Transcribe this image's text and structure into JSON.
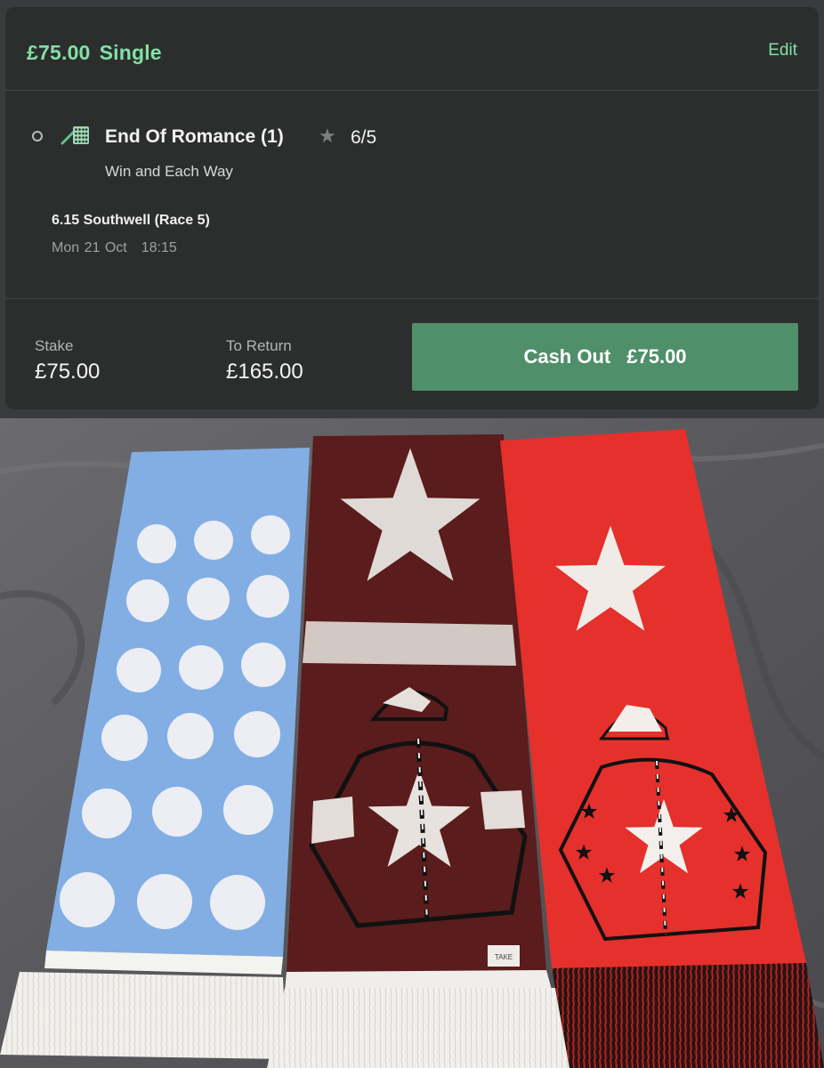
{
  "bet": {
    "amount": "£75.00",
    "type": "Single",
    "edit_label": "Edit",
    "selection": {
      "name": "End Of Romance (1)",
      "odds": "6/5",
      "market": "Win and Each Way",
      "race": "6.15 Southwell (Race 5)",
      "date": "Mon 21 Oct",
      "time": "18:15"
    },
    "stake_label": "Stake",
    "stake_value": "£75.00",
    "return_label": "To Return",
    "return_value": "£165.00",
    "cashout_label": "Cash Out",
    "cashout_value": "£75.00"
  },
  "colors": {
    "accent_green": "#82e0a6",
    "cashout_button": "#4f8f6a",
    "card_bg": "#2c2e2e"
  },
  "photo": {
    "scarf_labels": [
      "TAKE"
    ],
    "scarves": [
      {
        "name": "light-blue-spotted-scarf",
        "color": "#83aee4",
        "pattern": "white spots"
      },
      {
        "name": "maroon-star-scarf",
        "color": "#5a1c1c",
        "pattern": "white star, white hoop, jockey silks"
      },
      {
        "name": "red-star-scarf",
        "color": "#e5302c",
        "pattern": "white star, jockey silks"
      }
    ]
  }
}
